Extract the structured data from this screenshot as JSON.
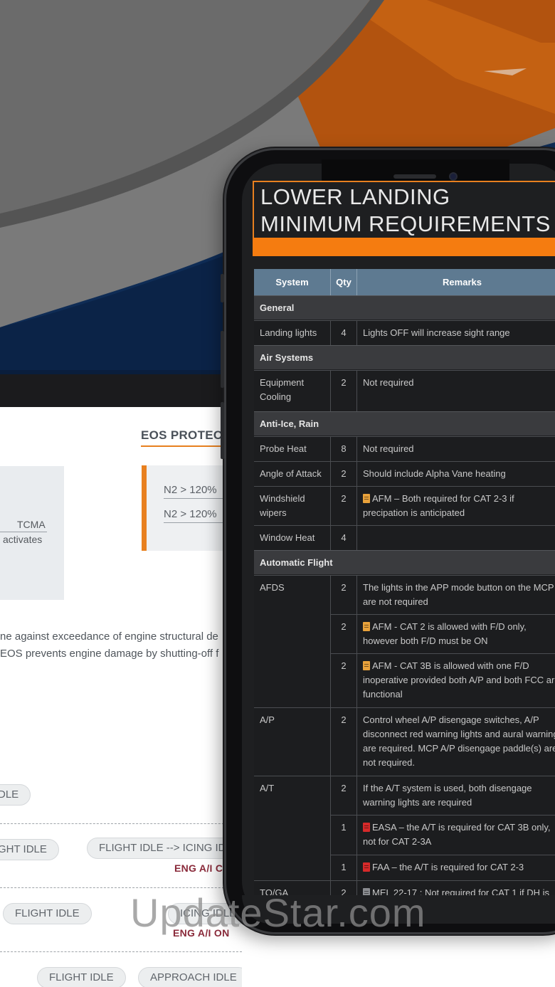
{
  "website": {
    "eos_heading": "EOS PROTEC",
    "tcma_label": "TCMA",
    "tcma_sub": "activates",
    "n2_rows": [
      "N2 >  120%",
      "N2 >  120%"
    ],
    "paragraph_lines": [
      "ne against exceedance of engine structural de",
      "EOS prevents engine damage by shutting-off f"
    ],
    "pills": {
      "idle_1": "DLE",
      "ght_idle": "GHT IDLE",
      "flight_to_icing": "FLIGHT IDLE --> ICING IDL",
      "flight_idle_1": "FLIGHT IDLE",
      "icing_idle": "ICING IDLE",
      "flight_idle_2": "FLIGHT IDLE",
      "approach_idle": "APPROACH IDLE"
    },
    "eng_ai_1": "ENG A/I C",
    "eng_ai_2": "ENG A/I ON"
  },
  "app": {
    "title": "LOWER LANDING MINIMUM REQUIREMENTS",
    "columns": [
      "System",
      "Qty",
      "Remarks"
    ],
    "sections": {
      "general": "General",
      "air_systems": "Air Systems",
      "anti_ice": "Anti-Ice, Rain",
      "auto_flight": "Automatic Flight"
    },
    "rows": {
      "landing_lights": {
        "system": "Landing lights",
        "qty": "4",
        "remarks": "Lights OFF will increase sight range"
      },
      "equip_cooling": {
        "system": "Equipment Cooling",
        "qty": "2",
        "remarks": "Not required"
      },
      "probe_heat": {
        "system": "Probe Heat",
        "qty": "8",
        "remarks": "Not required"
      },
      "aoa": {
        "system": "Angle of Attack",
        "qty": "2",
        "remarks": "Should include Alpha Vane heating"
      },
      "wipers": {
        "system": "Windshield wipers",
        "qty": "2",
        "remarks": "AFM – Both required for CAT 2-3 if precipation is anticipated"
      },
      "window_heat": {
        "system": "Window Heat",
        "qty": "4",
        "remarks": ""
      },
      "afds_1": {
        "system": "AFDS",
        "qty": "2",
        "remarks": "The lights in the APP mode button on the MCP are not required"
      },
      "afds_2": {
        "system": "",
        "qty": "2",
        "remarks": "AFM - CAT 2 is allowed with F/D only, however both F/D must be ON"
      },
      "afds_3": {
        "system": "",
        "qty": "2",
        "remarks": "AFM - CAT 3B is allowed with one F/D inoperative provided both A/P and both FCC are functional"
      },
      "ap": {
        "system": "A/P",
        "qty": "2",
        "remarks": "Control wheel A/P disengage switches, A/P disconnect red warning lights and aural warning are required. MCP A/P disengage paddle(s) are not required."
      },
      "at_1": {
        "system": "A/T",
        "qty": "2",
        "remarks": "If the A/T system is used, both disengage warning lights are required"
      },
      "at_2": {
        "system": "",
        "qty": "1",
        "remarks": "EASA – the A/T is required for CAT 3B only, not for CAT 2-3A"
      },
      "at_3": {
        "system": "",
        "qty": "1",
        "remarks": "FAA – the A/T is required for CAT 2-3"
      },
      "toga": {
        "system": "TO/GA",
        "qty": "2",
        "remarks": "MEL 22-17 : Not required for CAT 1 if DH is"
      }
    }
  },
  "watermark": "UpdateStar.com",
  "colors": {
    "accent_orange": "#f57c10",
    "header_blue": "#5e7a91",
    "section_gray": "#3a3b3e"
  }
}
